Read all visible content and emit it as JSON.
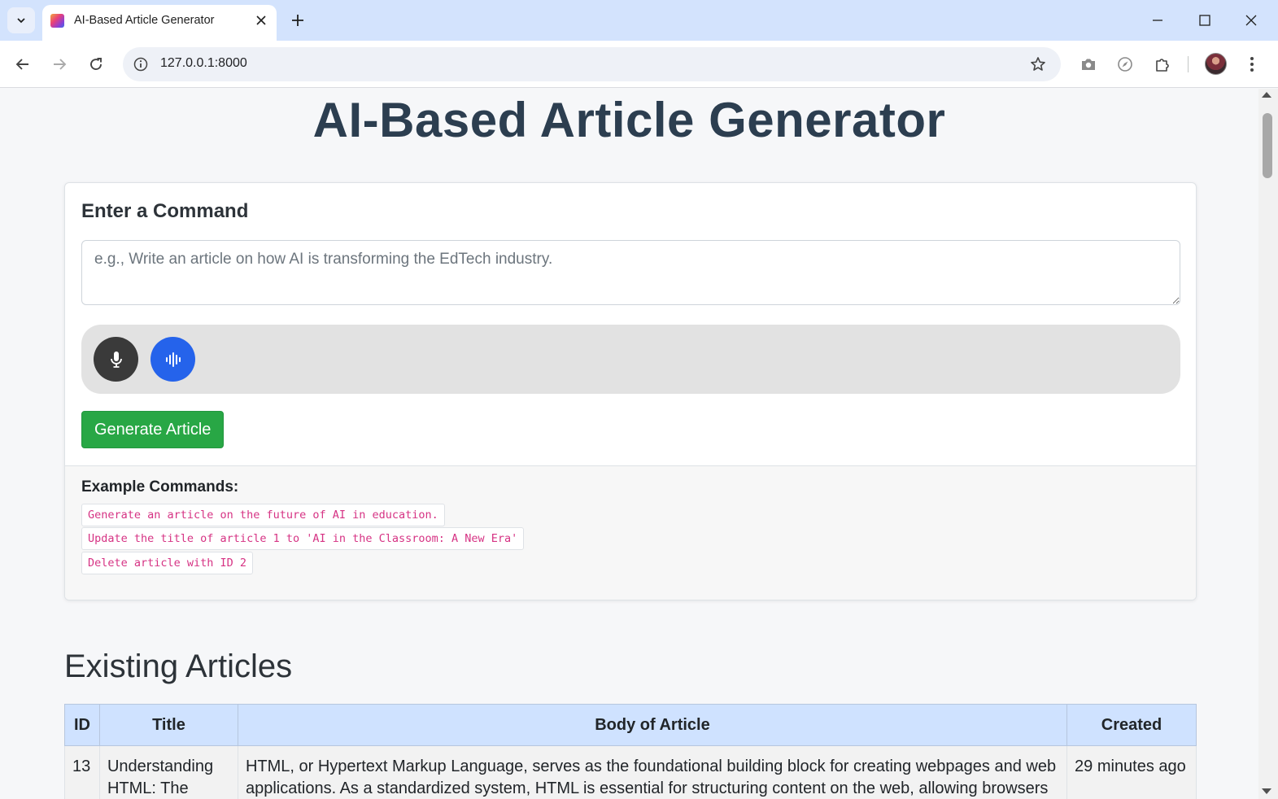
{
  "browser": {
    "tab_title": "AI-Based Article Generator",
    "url": "127.0.0.1:8000"
  },
  "page": {
    "title": "AI-Based Article Generator",
    "command_card": {
      "heading": "Enter a Command",
      "input_placeholder": "e.g., Write an article on how AI is transforming the EdTech industry.",
      "input_value": "",
      "generate_label": "Generate Article"
    },
    "examples": {
      "heading": "Example Commands:",
      "items": [
        "Generate an article on the future of AI in education.",
        "Update the title of article 1 to 'AI in the Classroom: A New Era'",
        "Delete article with ID 2"
      ]
    },
    "articles_section": {
      "heading": "Existing Articles",
      "columns": [
        "ID",
        "Title",
        "Body of Article",
        "Created"
      ],
      "rows": [
        {
          "id": "13",
          "title": "Understanding HTML: The",
          "body": "HTML, or Hypertext Markup Language, serves as the foundational building block for creating webpages and web applications. As a standardized system, HTML is essential for structuring content on the web, allowing browsers",
          "created": "29 minutes ago"
        }
      ]
    }
  },
  "colors": {
    "title": "#2c3e50",
    "generate_button": "#28a745",
    "mic_button": "#3a3a3a",
    "wave_button": "#2563eb",
    "example_text": "#d63384",
    "table_header": "#cfe2ff"
  },
  "icons": {
    "mic": "microphone-icon",
    "wave": "audio-wave-icon"
  }
}
